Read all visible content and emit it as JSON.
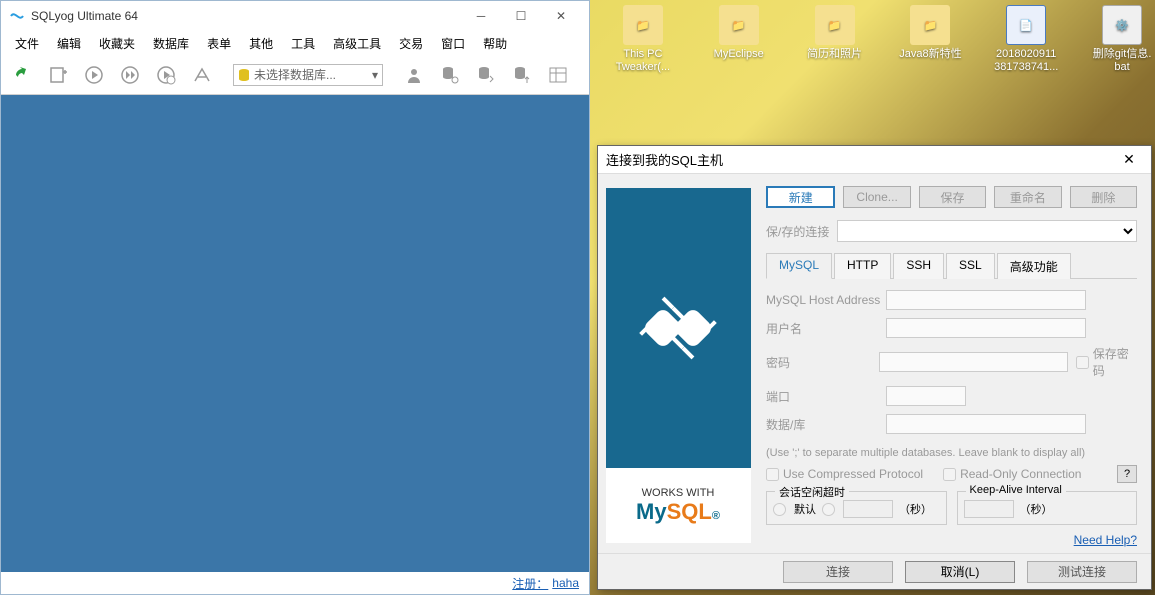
{
  "desktop": {
    "items": [
      {
        "label1": "This PC",
        "label2": "Tweaker(..."
      },
      {
        "label1": "MyEclipse",
        "label2": ""
      },
      {
        "label1": "简历和照片",
        "label2": ""
      },
      {
        "label1": "Java8新特性",
        "label2": ""
      },
      {
        "label1": "2018020911",
        "label2": "381738741..."
      },
      {
        "label1": "删除git信息.",
        "label2": "bat"
      }
    ]
  },
  "sqlyog": {
    "title": "SQLyog Ultimate 64",
    "menus": [
      "文件",
      "编辑",
      "收藏夹",
      "数据库",
      "表单",
      "其他",
      "工具",
      "高级工具",
      "交易",
      "窗口",
      "帮助"
    ],
    "db_placeholder": "未选择数据库...",
    "status_reg": "注册：",
    "status_user": "haha"
  },
  "dialog": {
    "title": "连接到我的SQL主机",
    "new": "新建",
    "clone": "Clone...",
    "save": "保存",
    "rename": "重命名",
    "delete": "删除",
    "saved_label": "保/存的连接",
    "tabs": [
      "MySQL",
      "HTTP",
      "SSH",
      "SSL",
      "高级功能"
    ],
    "host_label": "MySQL Host Address",
    "user_label": "用户名",
    "pwd_label": "密码",
    "save_pwd": "保存密码",
    "port_label": "端口",
    "db_label": "数据/库",
    "hint": "(Use ';' to separate multiple databases. Leave blank to display all)",
    "compressed": "Use Compressed Protocol",
    "readonly": "Read-Only Connection",
    "q": "?",
    "grp1_title": "会话空闲超时",
    "grp1_default": "默认",
    "grp1_sec": "（秒）",
    "grp2_title": "Keep-Alive Interval",
    "grp2_sec": "（秒）",
    "need_help": "Need Help?",
    "connect": "连接",
    "cancel": "取消(L)",
    "test": "测试连接",
    "worksw": "WORKS WITH"
  }
}
